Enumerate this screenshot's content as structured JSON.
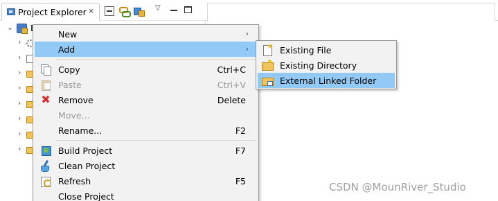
{
  "view": {
    "tab_title": "Project Explorer",
    "close_glyph": "×",
    "menu_glyph": "▽"
  },
  "tree": {
    "project_label": "B",
    "expanded_glyph": "⌄",
    "collapsed_glyph": "›"
  },
  "context_menu": {
    "items": [
      {
        "label": "New",
        "shortcut": "",
        "submenu": true,
        "enabled": true,
        "icon": "none"
      },
      {
        "label": "Add",
        "shortcut": "",
        "submenu": true,
        "enabled": true,
        "active": true,
        "icon": "none"
      },
      {
        "label": "Copy",
        "shortcut": "Ctrl+C",
        "enabled": true,
        "icon": "copy-icon"
      },
      {
        "label": "Paste",
        "shortcut": "Ctrl+V",
        "enabled": false,
        "icon": "paste-icon"
      },
      {
        "label": "Remove",
        "shortcut": "Delete",
        "enabled": true,
        "icon": "remove-icon"
      },
      {
        "label": "Move...",
        "shortcut": "",
        "enabled": false,
        "icon": "none"
      },
      {
        "label": "Rename...",
        "shortcut": "F2",
        "enabled": true,
        "icon": "none"
      },
      {
        "label": "Build Project",
        "shortcut": "F7",
        "enabled": true,
        "icon": "build-icon"
      },
      {
        "label": "Clean Project",
        "shortcut": "",
        "enabled": true,
        "icon": "clean-icon"
      },
      {
        "label": "Refresh",
        "shortcut": "F5",
        "enabled": true,
        "icon": "refresh-icon"
      },
      {
        "label": "Close Project",
        "shortcut": "",
        "enabled": true,
        "icon": "none"
      }
    ],
    "submenu_arrow": "›"
  },
  "add_submenu": {
    "items": [
      {
        "label": "Existing File",
        "icon": "existing-file-icon"
      },
      {
        "label": "Existing Directory",
        "icon": "existing-directory-icon"
      },
      {
        "label": "External Linked Folder",
        "icon": "linked-folder-icon",
        "active": true
      }
    ]
  },
  "watermark": "CSDN @MounRiver_Studio",
  "colors": {
    "menu_bg": "#f2f2f2",
    "highlight": "#91c9f7",
    "disabled_text": "#9a9a9a",
    "remove_red": "#d32f2f"
  }
}
